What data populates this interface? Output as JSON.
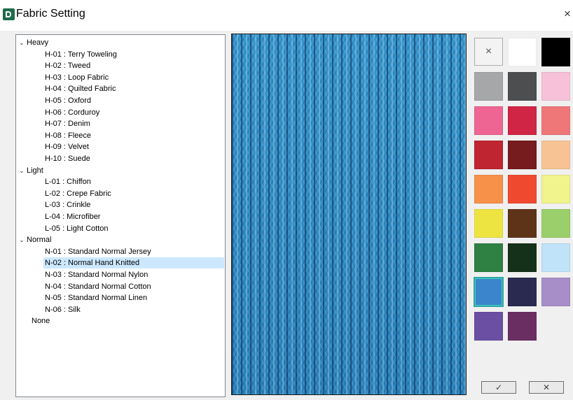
{
  "window": {
    "title": "Fabric Setting",
    "close_label": "×"
  },
  "tree": {
    "groups": [
      {
        "label": "Heavy",
        "items": [
          "H-01 : Terry Toweling",
          "H-02 : Tweed",
          "H-03 : Loop Fabric",
          "H-04 : Quilted Fabric",
          "H-05 : Oxford",
          "H-06 : Corduroy",
          "H-07 : Denim",
          "H-08 : Fleece",
          "H-09 : Velvet",
          "H-10 : Suede"
        ]
      },
      {
        "label": "Light",
        "items": [
          "L-01 : Chiffon",
          "L-02 : Crepe Fabric",
          "L-03 : Crinkle",
          "L-04 : Microfiber",
          "L-05 : Light Cotton"
        ]
      },
      {
        "label": "Normal",
        "items": [
          "N-01 : Standard Normal Jersey",
          "N-02 : Normal Hand Knitted",
          "N-03 : Standard Normal Nylon",
          "N-04 : Standard Normal Cotton",
          "N-05 : Standard Normal Linen",
          "N-06 : Silk"
        ]
      }
    ],
    "none_label": "None",
    "selected_item": "N-02 : Normal Hand Knitted"
  },
  "preview": {
    "fabric_icon": "knitted-fabric-texture",
    "color": "#2f8cc4"
  },
  "palette": {
    "clear_label": "×",
    "colors": [
      "#ffffff",
      "#000000",
      "#a6a7a9",
      "#4d4e50",
      "#f6c1d9",
      "#ee6593",
      "#d02544",
      "#ef7778",
      "#bf2530",
      "#761b1e",
      "#f8c394",
      "#f79149",
      "#ef4a2f",
      "#f1f38c",
      "#ede442",
      "#5e3419",
      "#9bcf6c",
      "#2e8142",
      "#15311a",
      "#c1e3f9",
      "#3a85cb",
      "#2a2a50",
      "#a78ec8",
      "#6b4fa3",
      "#6a2e63"
    ],
    "selected_color": "#3a85cb"
  },
  "buttons": {
    "ok_label": "✓",
    "cancel_label": "✕"
  }
}
